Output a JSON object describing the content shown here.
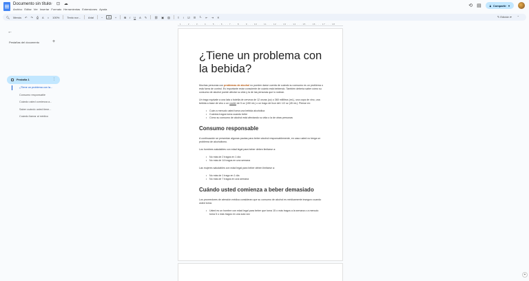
{
  "window": {
    "doc_title": "Documento sin título",
    "title_icons": "☆ ⊡ ☁",
    "menu": [
      "Archivo",
      "Editar",
      "Ver",
      "Insertar",
      "Formato",
      "Herramientas",
      "Extensiones",
      "Ayuda"
    ],
    "share_label": "Compartir",
    "history_icon": "history-icon",
    "comment_icon": "comment-icon"
  },
  "toolbar": {
    "search_label": "Menús",
    "zoom": "100%",
    "style": "Texto nor...",
    "font": "Arial",
    "font_size": "11",
    "mode": "Edición"
  },
  "sidebar": {
    "outline_title": "Pestañas del documento",
    "tab_label": "Pestaña 1",
    "items": [
      "¿Tiene un problema con la...",
      "Consumo responsable",
      "Cuándo usted comienza a...",
      "Saber cuándo usted tiene...",
      "Cuándo llamar al médico"
    ]
  },
  "document": {
    "h1": "¿Tiene un problema con la bebida?",
    "p1_a": "Muchas personas con ",
    "p1_link": "problemas de alcohol",
    "p1_b": " no pueden darse cuenta de cuándo su consumo es un problema o está fuera de control. Es importante estar consciente de cuánto está bebiendo. También debería saber cómo su consumo de alcohol puede afectar su vida y la de las personas que lo rodean.",
    "p2_a": "Un trago equivale a una lata o botella de cerveza de 12 onzas (oz) o 360 mililitros (mL), una copa de vino, una bebida a base de vino o un ",
    "p2_u": "cooler",
    "p2_b": " de 5 oz (150 mL) o un trago de licor de1 1/2 oz (45 mL). Piense en:",
    "list1": [
      "Cuán a menudo usted toma una bebida alcohólica",
      "Cuántos tragos toma cuando bebe",
      "Cómo su consumo de alcohol está afectando su vida o la de otras personas"
    ],
    "h2a": "Consumo responsable",
    "p3": "A continuación se presentan algunas pautas para beber alcohol responsablemente, en caso usted no tenga un problema de alcoholismo.",
    "p4": "Los hombres saludables con edad legal para beber deben limitarse a:",
    "list2": [
      "No más de 2 tragos en 1 día",
      "No más de 14 tragos en una semana"
    ],
    "p5": "Las mujeres saludables con edad legal para beber deben limitarse a:",
    "list3": [
      "No más de 1 trago en 1 día",
      "No más de 7 tragos en una semana"
    ],
    "h2b": "Cuándo usted comienza a beber demasiado",
    "p6": "Los proveedores de atención médica consideran que su consumo de alcohol es médicamente inseguro cuando usted toma:",
    "list4": [
      "Usted es un hombre con edad legal para beber que toma 15 o más tragos a la semana o a menudo toma 5 o más tragos en una sola vez"
    ]
  }
}
